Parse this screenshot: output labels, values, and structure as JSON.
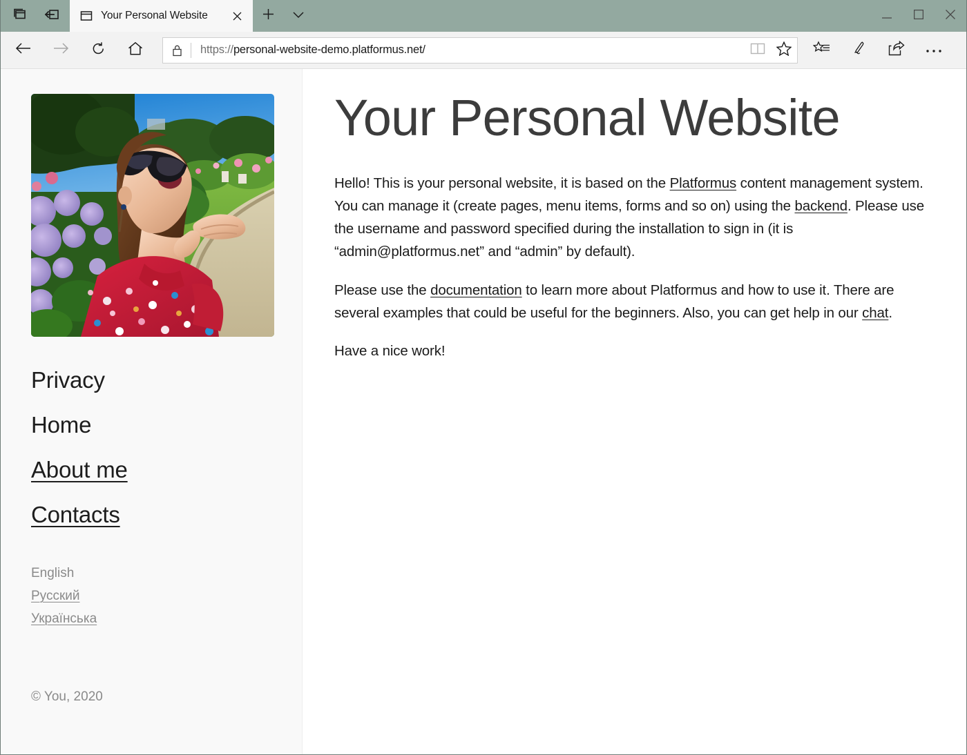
{
  "browser": {
    "tabbar": {
      "show_tabs_icon": "stacked-windows-icon",
      "set_aside_icon": "set-tabs-aside-icon",
      "tab": {
        "favicon": "page-icon",
        "title": "Your Personal Website",
        "close_icon": "close-icon"
      },
      "new_tab_icon": "plus-icon",
      "tab_menu_icon": "chevron-down-icon",
      "window_controls": {
        "minimize": "minimize-icon",
        "maximize": "maximize-icon",
        "close": "close-icon"
      },
      "bar_color": "#93a9a0"
    },
    "toolbar": {
      "back_icon": "back-arrow-icon",
      "forward_icon": "forward-arrow-icon",
      "refresh_icon": "refresh-icon",
      "home_icon": "home-icon",
      "lock_icon": "lock-icon",
      "url_scheme": "https://",
      "url_host": "personal-website-demo.platformus.net/",
      "url_full": "https://personal-website-demo.platformus.net/",
      "reading_view_icon": "book-icon",
      "favorite_icon": "star-icon",
      "hub_icon": "favorites-hub-icon",
      "web_note_icon": "pen-icon",
      "share_icon": "share-icon",
      "more_icon": "ellipsis-icon"
    }
  },
  "site": {
    "sidebar": {
      "photo_alt": "portrait-photo",
      "nav": [
        {
          "label": "Privacy",
          "is_link": false
        },
        {
          "label": "Home",
          "is_link": false
        },
        {
          "label": "About me",
          "is_link": true
        },
        {
          "label": "Contacts",
          "is_link": true
        }
      ],
      "languages": [
        {
          "label": "English",
          "is_link": false,
          "current": true
        },
        {
          "label": "Русский",
          "is_link": true,
          "current": false
        },
        {
          "label": "Українська",
          "is_link": true,
          "current": false
        }
      ],
      "copyright": "© You, 2020"
    },
    "main": {
      "title": "Your Personal Website",
      "paragraph1": {
        "t1": "Hello! This is your personal website, it is based on the ",
        "link1": "Platformus",
        "t2": " content management system. You can manage it (create pages, menu items, forms and so on) using the ",
        "link2": "backend",
        "t3": ". Please use the username and password specified during the installation to sign in (it is “admin@platformus.net” and “admin” by default)."
      },
      "paragraph2": {
        "t1": "Please use the ",
        "link1": "documentation",
        "t2": " to learn more about Platformus and how to use it. There are several examples that could be useful for the beginners. Also, you can get help in our ",
        "link2": "chat",
        "t3": "."
      },
      "paragraph3": "Have a nice work!"
    }
  },
  "colors": {
    "tabbar": "#93a9a0",
    "toolbar": "#f2f2f2",
    "sidebar": "#f9f9f9",
    "content": "#ffffff",
    "title": "#3c3c3c",
    "muted": "#8a8a8a"
  }
}
